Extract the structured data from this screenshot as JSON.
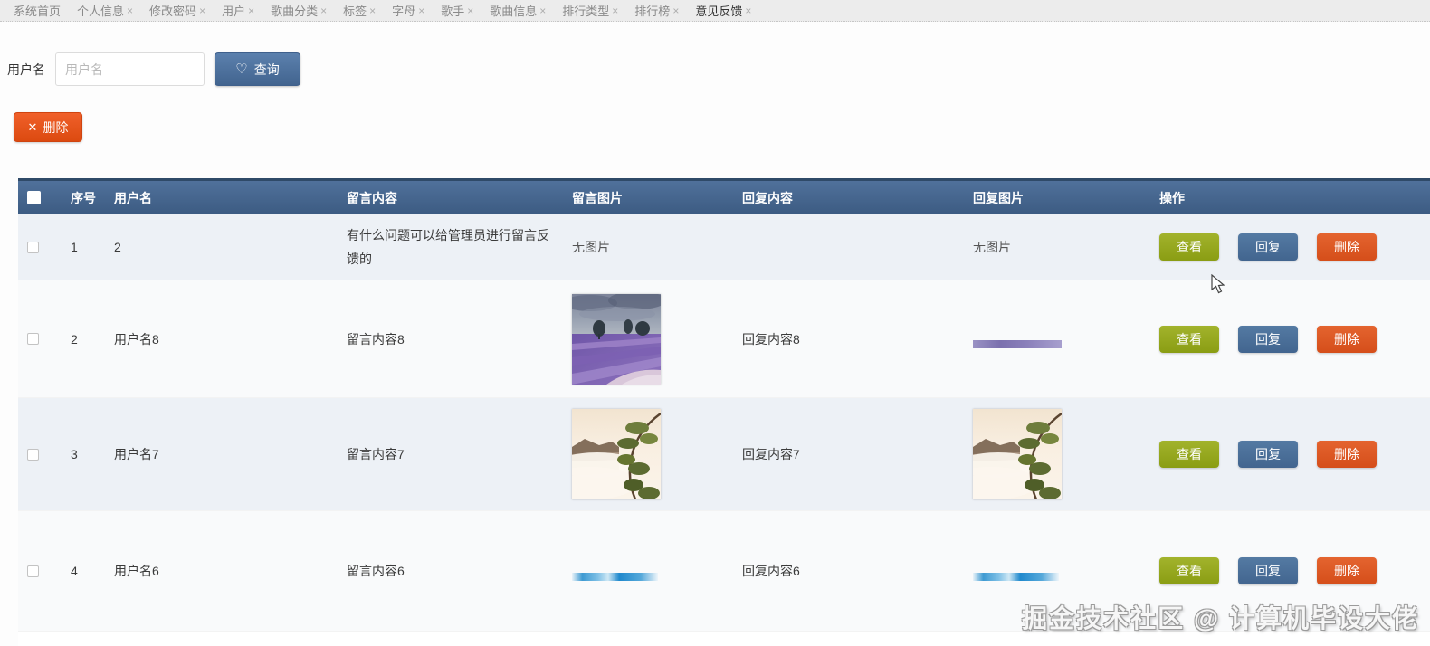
{
  "tab_bar": {
    "close_glyph": "×",
    "tabs": [
      {
        "label": "系统首页",
        "closable": false,
        "active": false
      },
      {
        "label": "个人信息",
        "closable": true,
        "active": false
      },
      {
        "label": "修改密码",
        "closable": true,
        "active": false
      },
      {
        "label": "用户",
        "closable": true,
        "active": false
      },
      {
        "label": "歌曲分类",
        "closable": true,
        "active": false
      },
      {
        "label": "标签",
        "closable": true,
        "active": false
      },
      {
        "label": "字母",
        "closable": true,
        "active": false
      },
      {
        "label": "歌手",
        "closable": true,
        "active": false
      },
      {
        "label": "歌曲信息",
        "closable": true,
        "active": false
      },
      {
        "label": "排行类型",
        "closable": true,
        "active": false
      },
      {
        "label": "排行榜",
        "closable": true,
        "active": false
      },
      {
        "label": "意见反馈",
        "closable": true,
        "active": true
      }
    ]
  },
  "search": {
    "label": "用户名",
    "placeholder": "用户名",
    "query_button": "查询",
    "heart_icon": "♡"
  },
  "toolbar": {
    "delete_button": "删除",
    "x_icon": "✕"
  },
  "table": {
    "headers": [
      "序号",
      "用户名",
      "留言内容",
      "留言图片",
      "回复内容",
      "回复图片",
      "操作"
    ],
    "no_image_text": "无图片",
    "actions": {
      "view": "查看",
      "reply": "回复",
      "delete": "删除"
    },
    "rows": [
      {
        "index": "1",
        "username": "2",
        "message": "有什么问题可以给管理员进行留言反馈的",
        "message_image": "none",
        "reply": "",
        "reply_image": "none"
      },
      {
        "index": "2",
        "username": "用户名8",
        "message": "留言内容8",
        "message_image": "lavender-field-photo",
        "reply": "回复内容8",
        "reply_image": "purple-strip-photo"
      },
      {
        "index": "3",
        "username": "用户名7",
        "message": "留言内容7",
        "message_image": "mountain-pine-photo",
        "reply": "回复内容7",
        "reply_image": "mountain-pine-photo"
      },
      {
        "index": "4",
        "username": "用户名6",
        "message": "留言内容6",
        "message_image": "sky-strip-photo",
        "reply": "回复内容6",
        "reply_image": "sky-strip-photo"
      }
    ]
  },
  "watermark": "掘金技术社区 @ 计算机毕设大佬",
  "colors": {
    "header_blue": "#46688f",
    "row_stripe": "#edf1f6",
    "row_alt": "#f9fafb",
    "view_green": "#96a81f",
    "reply_blue": "#4a7099",
    "delete_orange": "#dd5226",
    "query_blue": "#4a6d9b",
    "toolbar_delete_orange": "#e8541c",
    "tabbar_bg": "#ececec"
  }
}
